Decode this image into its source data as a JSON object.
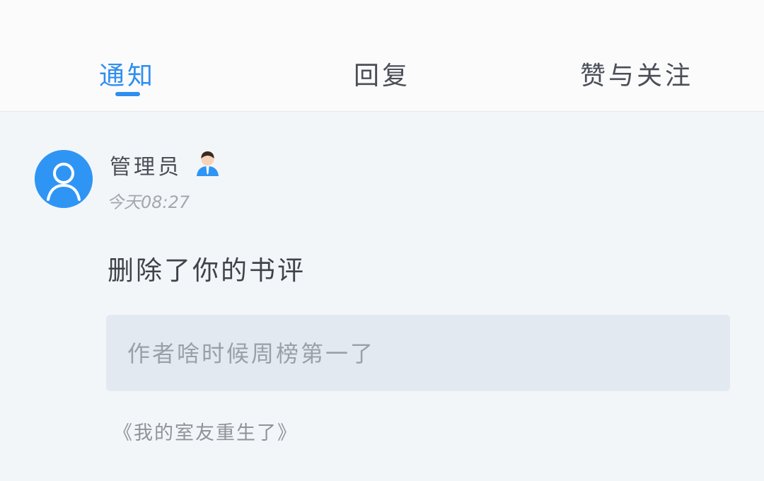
{
  "tabs": [
    {
      "label": "通知",
      "active": true
    },
    {
      "label": "回复",
      "active": false
    },
    {
      "label": "赞与关注",
      "active": false
    }
  ],
  "colors": {
    "accent": "#2f8ef0",
    "avatar_bg": "#2f95f5",
    "quote_bg": "#e3e9f0",
    "page_bg": "#f3f6f9"
  },
  "notification": {
    "avatar_icon": "user-avatar-icon",
    "badge_icon": "admin-badge-icon",
    "username": "管理员",
    "time": "今天08:27",
    "action": "删除了你的书评",
    "quote": "作者啥时候周榜第一了",
    "book_title": "《我的室友重生了》"
  }
}
